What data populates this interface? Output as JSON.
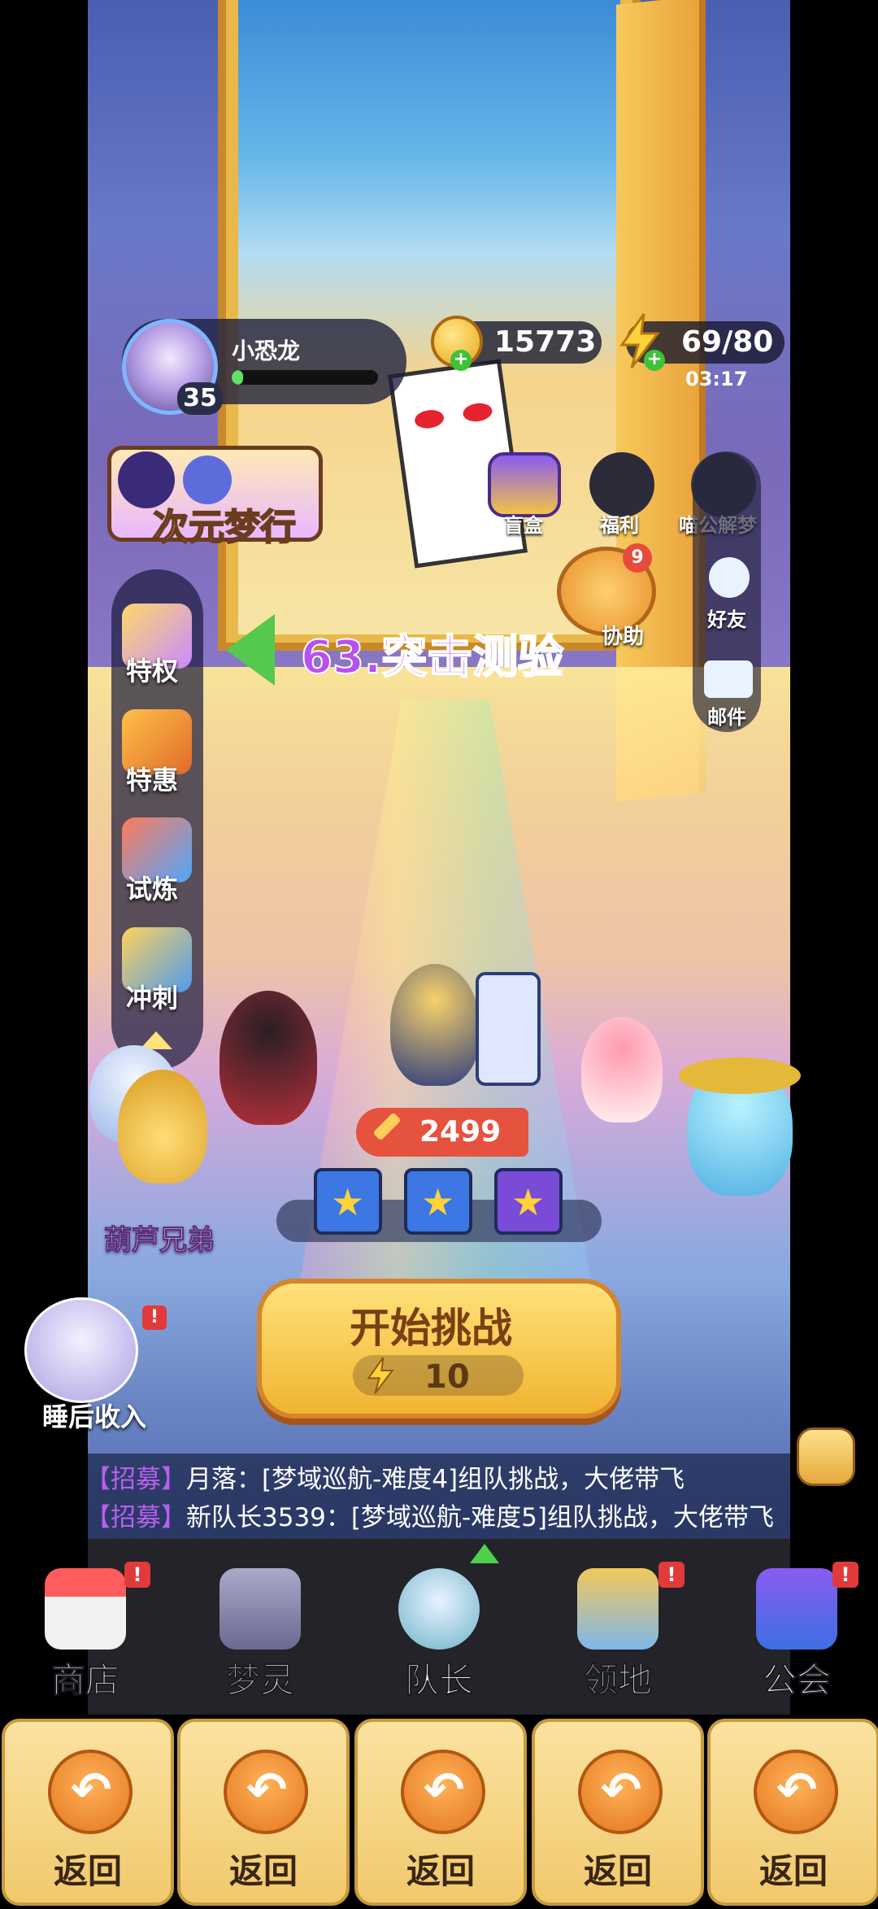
{
  "player": {
    "name": "小恐龙",
    "level": "35",
    "xp_fraction": 0.08
  },
  "resources": {
    "coins": "15773",
    "energy": "69/80",
    "energy_timer": "03:17"
  },
  "event_banner": {
    "label": "次元梦行"
  },
  "top_right": {
    "blind_box": "盲盒",
    "welfare": "福利",
    "meow_dream": "喵公解梦",
    "assist": "协助",
    "assist_badge": "9"
  },
  "right_column": {
    "friends": "好友",
    "mail": "邮件"
  },
  "left_column": {
    "privilege": "特权",
    "special_offer": "特惠",
    "trial": "试炼",
    "sprint": "冲刺"
  },
  "stage": {
    "title": "63.突击测验"
  },
  "team": {
    "power": "2499"
  },
  "gourd": {
    "label": "葫芦兄弟"
  },
  "start_button": {
    "label": "开始挑战",
    "cost": "10"
  },
  "idle": {
    "label": "睡后收入",
    "alert": "!"
  },
  "chat": {
    "lines": [
      {
        "tag": "【招募】",
        "text": "月落：[梦域巡航-难度4]组队挑战，大佬带飞"
      },
      {
        "tag": "【招募】",
        "text": "新队长3539：[梦域巡航-难度5]组队挑战，大佬带飞"
      }
    ]
  },
  "bottom_nav": {
    "items": [
      {
        "label": "商店",
        "alert": "!"
      },
      {
        "label": "梦灵",
        "alert": ""
      },
      {
        "label": "队长",
        "alert": ""
      },
      {
        "label": "领地",
        "alert": "!"
      },
      {
        "label": "公会",
        "alert": "!"
      }
    ]
  },
  "back_buttons": [
    "返回",
    "返回",
    "返回",
    "返回",
    "返回"
  ],
  "colors": {
    "accent_purple": "#b84ff2",
    "start_button": "#f1b431",
    "nav_bg": "#232329"
  }
}
